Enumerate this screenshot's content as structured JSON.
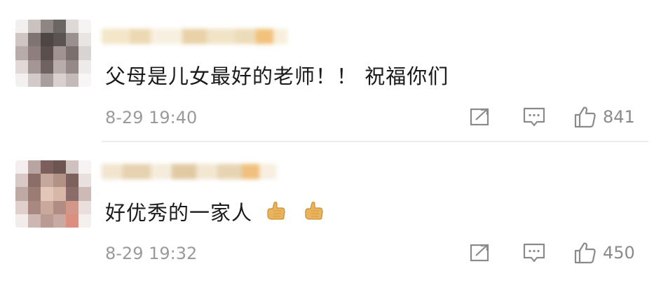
{
  "comments": [
    {
      "text": "父母是儿女最好的老师！！ 祝福你们",
      "timestamp": "8-29 19:40",
      "likes": "841"
    },
    {
      "text": "好优秀的一家人",
      "emoji": "👍👍",
      "timestamp": "8-29 19:32",
      "likes": "450"
    }
  ],
  "icons": {
    "share": "share-icon",
    "comment": "comment-icon",
    "like": "thumbs-up-icon"
  },
  "colors": {
    "text": "#1a1a1a",
    "meta": "#9a9a9a",
    "icon": "#8a8a8a",
    "divider": "#ececec"
  }
}
